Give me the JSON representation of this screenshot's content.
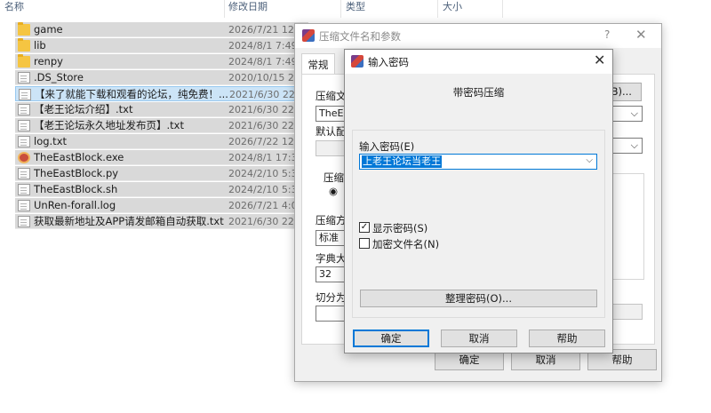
{
  "explorer": {
    "columns": {
      "name": "名称",
      "date": "修改日期",
      "type": "类型",
      "size": "大小"
    },
    "files": [
      {
        "name": "game",
        "date": "2026/7/21 12:",
        "icon": "folder-icon"
      },
      {
        "name": "lib",
        "date": "2024/8/1 7:49",
        "icon": "folder-icon"
      },
      {
        "name": "renpy",
        "date": "2024/8/1 7:49",
        "icon": "folder-icon"
      },
      {
        "name": ".DS_Store",
        "date": "2020/10/15 2:",
        "icon": "file-icon"
      },
      {
        "name": "【来了就能下载和观看的论坛，纯免费！...",
        "date": "2021/6/30 22:",
        "icon": "file-icon"
      },
      {
        "name": "【老王论坛介绍】.txt",
        "date": "2021/6/30 22:",
        "icon": "file-icon"
      },
      {
        "name": "【老王论坛永久地址发布页】.txt",
        "date": "2021/6/30 22:",
        "icon": "file-icon"
      },
      {
        "name": "log.txt",
        "date": "2026/7/22 12:",
        "icon": "file-icon"
      },
      {
        "name": "TheEastBlock.exe",
        "date": "2024/8/1 17:3",
        "icon": "exe-icon"
      },
      {
        "name": "TheEastBlock.py",
        "date": "2024/2/10 5:3",
        "icon": "file-icon"
      },
      {
        "name": "TheEastBlock.sh",
        "date": "2024/2/10 5:3",
        "icon": "file-icon"
      },
      {
        "name": "UnRen-forall.log",
        "date": "2026/7/21 4:0",
        "icon": "file-icon"
      },
      {
        "name": "获取最新地址及APP请发邮箱自动获取.txt",
        "date": "2021/6/30 22:",
        "icon": "file-icon"
      }
    ]
  },
  "archive_dialog": {
    "title": "压缩文件名和参数",
    "help": "?",
    "close": "✕",
    "tab_general": "常规",
    "archive_name_label": "压缩文",
    "archive_name_value": "TheEas",
    "browse_button": "(B)...",
    "default_config_label": "默认配",
    "format_label": "压缩",
    "method_label": "压缩方",
    "method_value": "标准",
    "dict_label": "字典大",
    "dict_value": "32",
    "split_label": "切分为",
    "ok": "确定",
    "cancel": "取消",
    "help_button": "帮助"
  },
  "password_dialog": {
    "title": "输入密码",
    "close": "✕",
    "heading": "带密码压缩",
    "enter_password_label": "输入密码(E)",
    "password_value": "上老王论坛当老王",
    "show_password_label": "显示密码(S)",
    "show_password_checked": true,
    "encrypt_filenames_label": "加密文件名(N)",
    "encrypt_filenames_checked": false,
    "organize_button": "整理密码(O)...",
    "ok": "确定",
    "cancel": "取消",
    "help": "帮助"
  }
}
